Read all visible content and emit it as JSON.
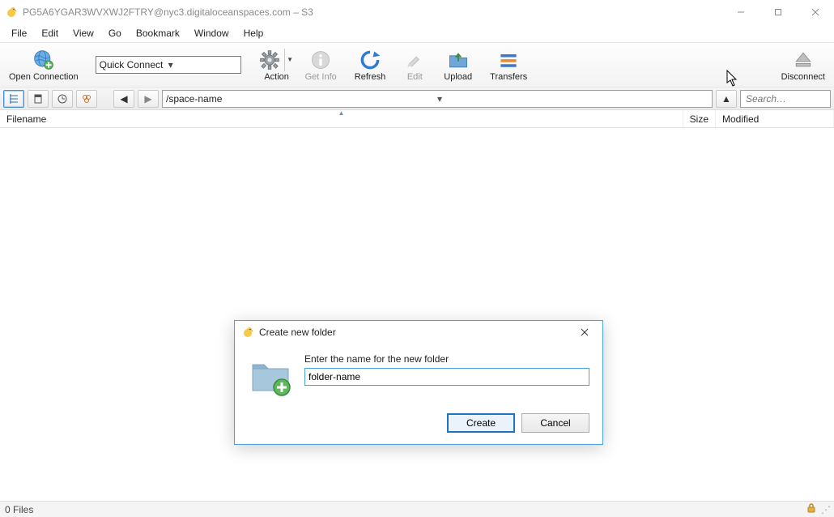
{
  "titlebar": {
    "title": "PG5A6YGAR3WVXWJ2FTRY@nyc3.digitaloceanspaces.com – S3"
  },
  "menu": {
    "file": "File",
    "edit": "Edit",
    "view": "View",
    "go": "Go",
    "bookmark": "Bookmark",
    "window": "Window",
    "help": "Help"
  },
  "toolbar": {
    "open_connection": "Open Connection",
    "quick_connect": "Quick Connect",
    "action": "Action",
    "get_info": "Get Info",
    "refresh": "Refresh",
    "edit": "Edit",
    "upload": "Upload",
    "transfers": "Transfers",
    "disconnect": "Disconnect"
  },
  "pathbar": {
    "path": "/space-name",
    "search_placeholder": "Search…"
  },
  "columns": {
    "filename": "Filename",
    "size": "Size",
    "modified": "Modified"
  },
  "statusbar": {
    "count": "0 Files"
  },
  "dialog": {
    "title": "Create new folder",
    "prompt": "Enter the name for the new folder",
    "input_value": "folder-name",
    "create": "Create",
    "cancel": "Cancel"
  }
}
